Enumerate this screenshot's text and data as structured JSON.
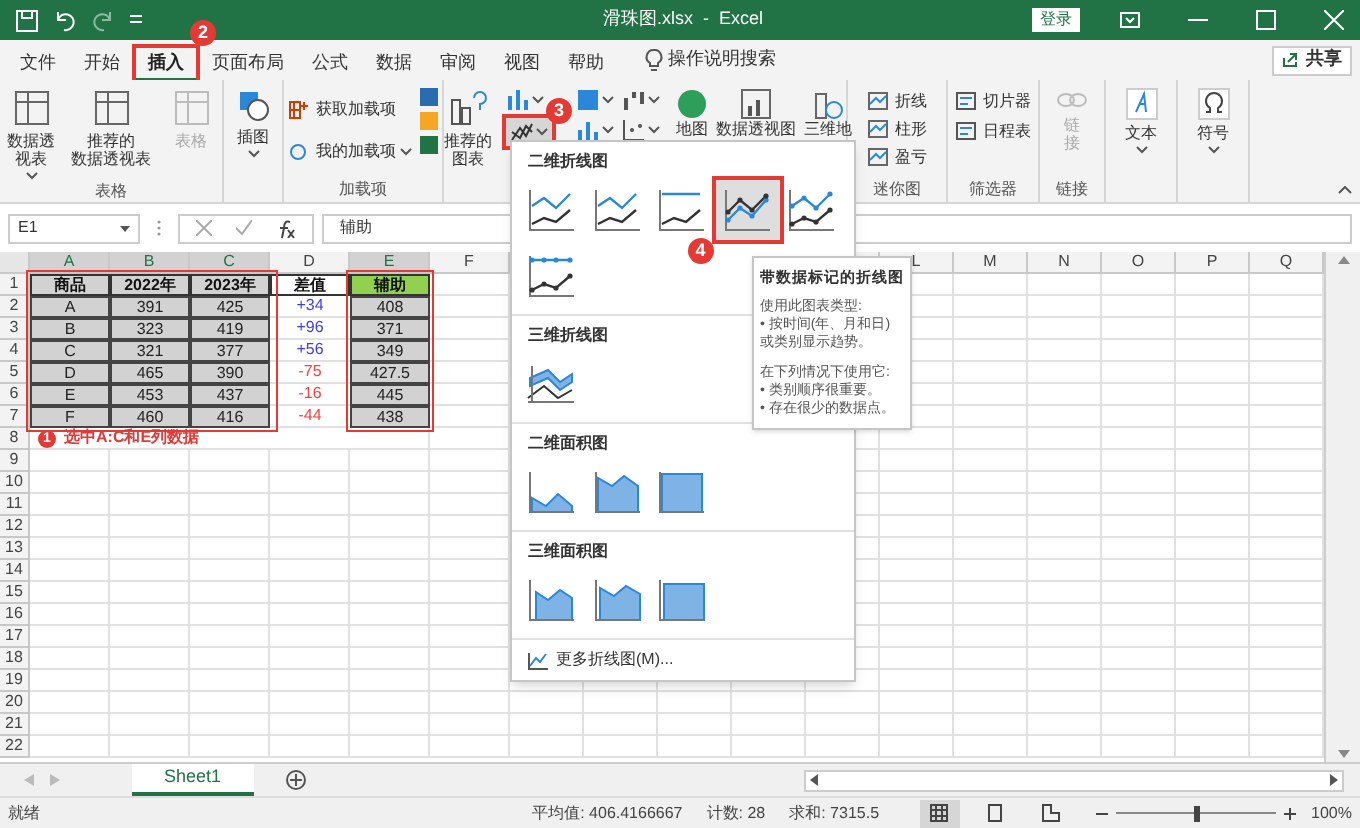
{
  "title_bar": {
    "title": "滑珠图.xlsx  -  Excel",
    "sign_in": "登录"
  },
  "menu_tabs": [
    {
      "label": "文件",
      "selected": false
    },
    {
      "label": "开始",
      "selected": false
    },
    {
      "label": "插入",
      "selected": true,
      "callout": "2"
    },
    {
      "label": "页面布局",
      "selected": false
    },
    {
      "label": "公式",
      "selected": false
    },
    {
      "label": "数据",
      "selected": false
    },
    {
      "label": "审阅",
      "selected": false
    },
    {
      "label": "视图",
      "selected": false
    },
    {
      "label": "帮助",
      "selected": false
    }
  ],
  "tell_me": "操作说明搜索",
  "share": "共享",
  "ribbon": {
    "table_group": {
      "label": "表格",
      "buttons": [
        {
          "lines": [
            "数据透",
            "视表"
          ],
          "dropdown": true,
          "disabled": false
        },
        {
          "lines": [
            "推荐的",
            "数据透视表"
          ],
          "dropdown": false,
          "disabled": false
        },
        {
          "lines": [
            "表格"
          ],
          "dropdown": false,
          "disabled": true
        }
      ]
    },
    "illustrations": "插图",
    "addins_group": {
      "label": "加载项",
      "get": "获取加载项",
      "mine": "我的加载项"
    },
    "charts_group": {
      "recommended": [
        "推荐的",
        "图表"
      ],
      "line_callout": "3",
      "map": "地图",
      "pivot_chart": "数据透视图",
      "map3d": "三维地"
    },
    "sparklines_group": {
      "label": "迷你图",
      "items": [
        "折线",
        "柱形",
        "盈亏"
      ]
    },
    "filters_group": {
      "label": "筛选器",
      "items": [
        "切片器",
        "日程表"
      ]
    },
    "links_group": {
      "label": "链接",
      "button": [
        "链",
        "接"
      ],
      "disabled": true
    },
    "text_button": "文本",
    "symbol_button": "符号"
  },
  "formula_bar": {
    "name_box": "E1",
    "value": "辅助"
  },
  "sheet": {
    "columns": [
      {
        "label": "A",
        "selected": true
      },
      {
        "label": "B",
        "selected": true
      },
      {
        "label": "C",
        "selected": true
      },
      {
        "label": "D",
        "selected": false
      },
      {
        "label": "E",
        "selected": true
      },
      {
        "label": "F",
        "selected": false
      }
    ],
    "right_columns": [
      {
        "label": "L",
        "selected": false
      },
      {
        "label": "M",
        "selected": false
      },
      {
        "label": "N",
        "selected": false
      },
      {
        "label": "O",
        "selected": false
      },
      {
        "label": "P",
        "selected": false
      },
      {
        "label": "Q",
        "selected": false
      }
    ],
    "row_numbers": [
      "1",
      "2",
      "3",
      "4",
      "5",
      "6",
      "7",
      "8",
      "9",
      "10",
      "11",
      "12",
      "13",
      "14",
      "15",
      "16",
      "17",
      "18",
      "19",
      "20",
      "21",
      "22"
    ],
    "header_row": [
      {
        "text": "商品",
        "active": false
      },
      {
        "text": "2022年",
        "active": false
      },
      {
        "text": "2023年",
        "active": false
      },
      {
        "text": "差值",
        "active": false
      },
      {
        "text": "辅助",
        "active": true
      }
    ],
    "rows": [
      {
        "cells": [
          {
            "text": "A"
          },
          {
            "text": "391"
          },
          {
            "text": "425"
          },
          {
            "text": "+34",
            "color": "#3c3cff"
          },
          {
            "text": "408"
          }
        ]
      },
      {
        "cells": [
          {
            "text": "B"
          },
          {
            "text": "323"
          },
          {
            "text": "419"
          },
          {
            "text": "+96",
            "color": "#3c3cff"
          },
          {
            "text": "371"
          }
        ]
      },
      {
        "cells": [
          {
            "text": "C"
          },
          {
            "text": "321"
          },
          {
            "text": "377"
          },
          {
            "text": "+56",
            "color": "#3c3cff"
          },
          {
            "text": "349"
          }
        ]
      },
      {
        "cells": [
          {
            "text": "D"
          },
          {
            "text": "465"
          },
          {
            "text": "390"
          },
          {
            "text": "-75",
            "color": "#ff3c3c"
          },
          {
            "text": "427.5"
          }
        ]
      },
      {
        "cells": [
          {
            "text": "E"
          },
          {
            "text": "453"
          },
          {
            "text": "437"
          },
          {
            "text": "-16",
            "color": "#ff3c3c"
          },
          {
            "text": "445"
          }
        ]
      },
      {
        "cells": [
          {
            "text": "F"
          },
          {
            "text": "460"
          },
          {
            "text": "416"
          },
          {
            "text": "-44",
            "color": "#ff3c3c"
          },
          {
            "text": "438"
          }
        ]
      }
    ],
    "note": {
      "badge": "1",
      "text": "选中A:C和E列数据"
    }
  },
  "chart_menu": {
    "callout": "4",
    "sections": [
      {
        "title": "二维折线图",
        "items": [
          {
            "kind": "line",
            "selected": false
          },
          {
            "kind": "stacked-line",
            "selected": false
          },
          {
            "kind": "percent-line",
            "selected": false
          },
          {
            "kind": "line-markers",
            "selected": true
          },
          {
            "kind": "stacked-line-markers",
            "selected": false
          },
          {
            "kind": "percent-line-markers",
            "selected": false
          }
        ]
      },
      {
        "title": "三维折线图",
        "items": [
          {
            "kind": "line-3d",
            "selected": false
          }
        ]
      },
      {
        "title": "二维面积图",
        "items": [
          {
            "kind": "area",
            "selected": false
          },
          {
            "kind": "stacked-area",
            "selected": false
          },
          {
            "kind": "percent-area",
            "selected": false
          }
        ]
      },
      {
        "title": "三维面积图",
        "items": [
          {
            "kind": "area-3d",
            "selected": false
          },
          {
            "kind": "stacked-area-3d",
            "selected": false
          },
          {
            "kind": "percent-area-3d",
            "selected": false
          }
        ]
      }
    ],
    "more": "更多折线图(M)..."
  },
  "tooltip": {
    "title": "带数据标记的折线图",
    "paragraphs": [
      [
        "使用此图表类型:",
        "• 按时间(年、月和日)",
        "或类别显示趋势。"
      ],
      [
        "在下列情况下使用它:",
        "• 类别顺序很重要。",
        "• 存在很少的数据点。"
      ]
    ]
  },
  "sheet_tabs": [
    {
      "label": "Sheet1",
      "selected": true
    }
  ],
  "status_bar": {
    "ready": "就绪",
    "average": "平均值: 406.4166667",
    "count": "计数: 28",
    "sum": "求和: 7315.5",
    "views": [
      {
        "kind": "normal",
        "selected": true
      },
      {
        "kind": "page-layout",
        "selected": false
      },
      {
        "kind": "page-break",
        "selected": false
      }
    ],
    "zoom": {
      "level": 0.5,
      "text": "100%"
    }
  }
}
